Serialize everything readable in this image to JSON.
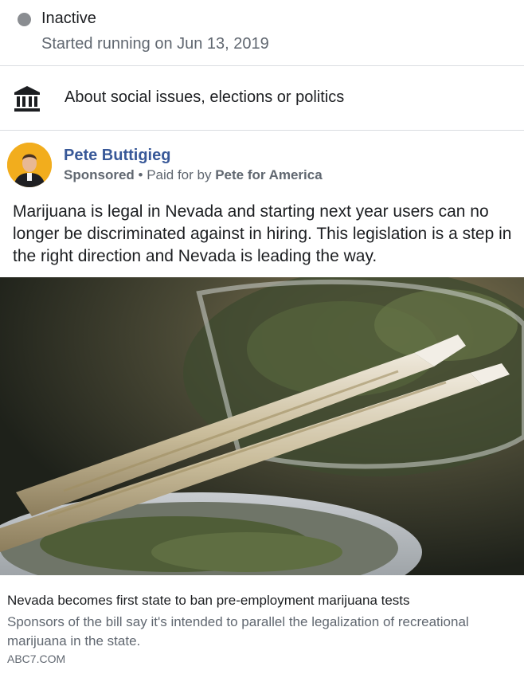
{
  "status": {
    "label": "Inactive",
    "started": "Started running on Jun 13, 2019",
    "dot_color": "#8a8d91"
  },
  "category": {
    "icon": "government-building-icon",
    "label": "About social issues, elections or politics"
  },
  "ad": {
    "advertiser": "Pete Buttigieg",
    "sponsored": "Sponsored",
    "separator": " • ",
    "paid_for_prefix": "Paid for by ",
    "paid_for_by": "Pete for America",
    "body": "Marijuana is legal in Nevada and starting next year users can no longer be discriminated against in hiring. This legislation is a step in the right direction and Nevada is leading the way.",
    "link": {
      "title": "Nevada becomes first state to ban pre-employment marijuana tests",
      "description": "Sponsors of the bill say it's intended to parallel the legalization of recreational marijuana in the state.",
      "domain": "ABC7.COM"
    }
  },
  "colors": {
    "advertiser_link": "#385898",
    "secondary_text": "#606770",
    "divider": "#dadde1"
  }
}
